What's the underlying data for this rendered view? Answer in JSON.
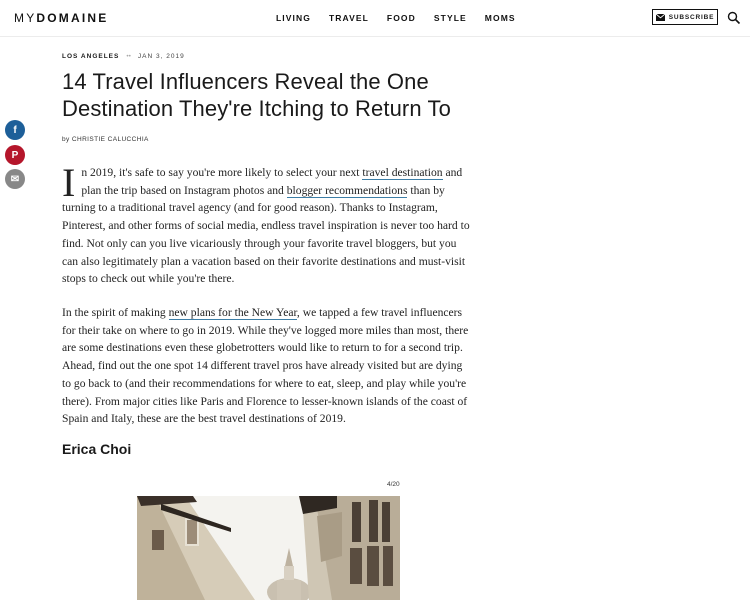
{
  "header": {
    "logo_my": "MY",
    "logo_domaine": "DOMAINE",
    "nav": [
      "LIVING",
      "TRAVEL",
      "FOOD",
      "STYLE",
      "MOMS"
    ],
    "subscribe_label": "SUBSCRIBE"
  },
  "share": {
    "facebook": "f",
    "pinterest": "P",
    "email": "✉"
  },
  "article": {
    "location": "LOS ANGELES",
    "meta_separator": "••",
    "date": "JAN 3, 2019",
    "title": "14 Travel Influencers Reveal the One Destination They're Itching to Return To",
    "byline_prefix": "by ",
    "author": "CHRISTIE CALUCCHIA",
    "p1": {
      "dropcap": "I",
      "t1": "n 2019, it's safe to say you're more likely to select your next ",
      "l1": "travel destination",
      "t2": " and plan the trip based on Instagram photos and ",
      "l2": "blogger recommendations",
      "t3": " than by turning to a traditional travel agency (and for good reason). Thanks to Instagram, Pinterest, and other forms of social media, endless travel inspiration is never too hard to find. Not only can you live vicariously through your favorite travel bloggers, but you can also legitimately plan a vacation based on their favorite destinations and must-visit stops to check out while you're there."
    },
    "p2": {
      "t1": "In the spirit of making ",
      "l1": "new plans for the New Year",
      "t2": ", we tapped a few travel influencers for their take on where to go in 2019. While they've logged more miles than most, there are some destinations even these globetrotters would like to return to for a second trip. Ahead, find out the one spot 14 different travel pros have already visited but are dying to go back to (and their recommendations for where to eat, sleep, and play while you're there). From major cities like Paris and Florence to lesser-known islands of the coast of Spain and Italy, these are the best travel destinations of 2019."
    },
    "subheading": "Erica Choi",
    "slide_counter": "4/20"
  },
  "colors": {
    "facebook": "#1d5f99",
    "pinterest": "#b5162b",
    "email": "#888888",
    "link_underline": "#3d7ea6"
  }
}
